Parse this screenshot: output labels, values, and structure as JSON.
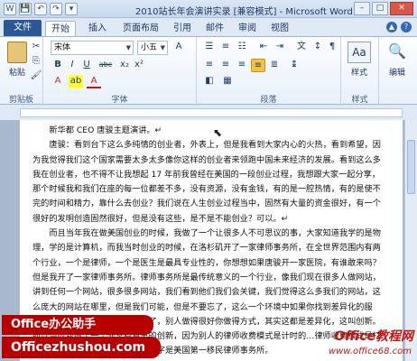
{
  "window": {
    "title": "2010站长年会演讲实录 [兼容模式] - Microsoft Word",
    "qat": [
      "W",
      "💾",
      "↶",
      "↷",
      "▾"
    ],
    "controls": {
      "min": "–",
      "max": "□",
      "close": "✕"
    }
  },
  "tabs": {
    "file": "文件",
    "items": [
      "开始",
      "插入",
      "页面布局",
      "引用",
      "邮件",
      "审阅",
      "视图"
    ],
    "active": "开始"
  },
  "ribbon": {
    "clipboard": {
      "paste": "粘贴",
      "label": "剪贴板"
    },
    "font": {
      "name": "宋体",
      "size": "小五",
      "label": "字体",
      "buttons": [
        "B",
        "I",
        "U",
        "abc",
        "x₂",
        "x²",
        "A",
        "A"
      ]
    },
    "paragraph": {
      "label": "段落"
    },
    "styles": {
      "style": "样式",
      "label": "样式"
    },
    "editing": {
      "label": "编辑"
    }
  },
  "document": {
    "paragraphs": [
      {
        "text": "新华都 CEO 唐骏主题演讲。↵"
      },
      {
        "text": "唐骏：看到台下这么多纯情的创业者，外表上，但是我看到大家内心的火热，看到希望，因为我觉得我们这个国家需要太多太多像你这样的创业者来领跑中国未来经济的发展。看到这么多我在创业者，也不得不让我想起 17 年前我曾经在美国的一段创业过程，我想跟大家一起分享，那个时候我和我们在座的每一位都差不多，没有资源，没有金钱，有的是一腔热情，有的是使不完的时间和精力，靠什么去创业？我们说在人生创业过程当中，固然有大量的资金很好，有一个很好的发明创造固然很好，但是没有这些，是不是不能创业？可以。↵"
      },
      {
        "text": "而且当年我在做美国创业的时候，我做了一个让很多人不可思议的事，大家知道我学的是物理，学的是计算机，而我当时创业的时候，在洛杉矶开了一家律师事务所，在全世界范围内有两个行业，一个是律师，一个是医生是最具专业性的，你想想如果唐骏开一家医院，有谁敢来吗？但是我开了一家律师事务所。律师事务所是最传统意义的一个行业，像我们现在很多人做网站，讲到任何一个网站，很多很多网站，我们看到他们我们会关键，我们觉得这么多我们的网站，这么庞大的网站在哪里，但是我们可能，但是不要忘了，这么一个环境中如果你找到差异化的服务，也就是说别人没有做的你做了，别人做得很好你做得方式，其实这都是差异化，这叫创新。所以当时我做了一个非常有意思的创新，因为别人的律师收费模式是计时的…律师收费模式是打包形式的，我当时的律师事务所名字是美国第一移民律师事务所。"
      }
    ]
  },
  "watermarks": {
    "brand_cn": "Office办公助手",
    "brand_url": "Officezhushou.com",
    "site": "Office教程网",
    "site_url": "www.office68.com"
  }
}
